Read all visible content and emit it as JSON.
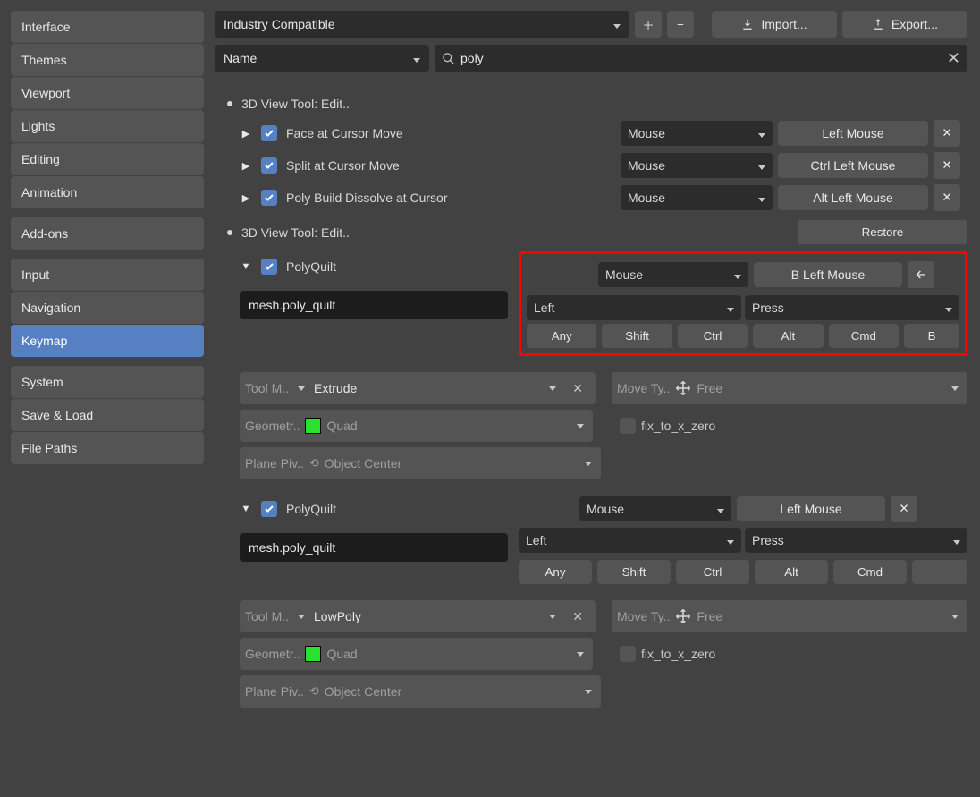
{
  "sidebar": {
    "groups": [
      [
        "Interface",
        "Themes",
        "Viewport",
        "Lights",
        "Editing",
        "Animation"
      ],
      [
        "Add-ons"
      ],
      [
        "Input",
        "Navigation",
        "Keymap"
      ],
      [
        "System",
        "Save & Load",
        "File Paths"
      ]
    ],
    "active": "Keymap"
  },
  "topbar": {
    "preset": "Industry Compatible",
    "import_label": "Import...",
    "export_label": "Export..."
  },
  "filter": {
    "mode": "Name",
    "query": "poly"
  },
  "sections": [
    {
      "title": "3D View Tool: Edit..",
      "restore": null,
      "rows": [
        {
          "expand": "right",
          "enabled": true,
          "name": "Face at Cursor Move",
          "type": "Mouse",
          "key": "Left Mouse"
        },
        {
          "expand": "right",
          "enabled": true,
          "name": "Split at Cursor Move",
          "type": "Mouse",
          "key": "Ctrl Left Mouse"
        },
        {
          "expand": "right",
          "enabled": true,
          "name": "Poly Build Dissolve at Cursor",
          "type": "Mouse",
          "key": "Alt Left Mouse"
        }
      ]
    },
    {
      "title": "3D View Tool: Edit..",
      "restore": "Restore",
      "expanded": [
        {
          "highlight": true,
          "enabled": true,
          "name": "PolyQuilt",
          "type": "Mouse",
          "key": "B Left Mouse",
          "back_arrow": true,
          "identifier": "mesh.poly_quilt",
          "mouse_btn": "Left",
          "mouse_evt": "Press",
          "mods": [
            "Any",
            "Shift",
            "Ctrl",
            "Alt",
            "Cmd",
            "B"
          ],
          "props": {
            "tool_mode_label": "Tool M..",
            "tool_mode_value": "Extrude",
            "move_type_label": "Move Ty..",
            "move_type_value": "Free",
            "geometry_label": "Geometr..",
            "geometry_value": "Quad",
            "fix_label": "fix_to_x_zero",
            "plane_label": "Plane Piv..",
            "plane_value": "Object Center"
          }
        },
        {
          "highlight": false,
          "enabled": true,
          "name": "PolyQuilt",
          "type": "Mouse",
          "key": "Left Mouse",
          "back_arrow": false,
          "identifier": "mesh.poly_quilt",
          "mouse_btn": "Left",
          "mouse_evt": "Press",
          "mods": [
            "Any",
            "Shift",
            "Ctrl",
            "Alt",
            "Cmd",
            ""
          ],
          "props": {
            "tool_mode_label": "Tool M..",
            "tool_mode_value": "LowPoly",
            "move_type_label": "Move Ty..",
            "move_type_value": "Free",
            "geometry_label": "Geometr..",
            "geometry_value": "Quad",
            "fix_label": "fix_to_x_zero",
            "plane_label": "Plane Piv..",
            "plane_value": "Object Center"
          }
        }
      ]
    }
  ]
}
